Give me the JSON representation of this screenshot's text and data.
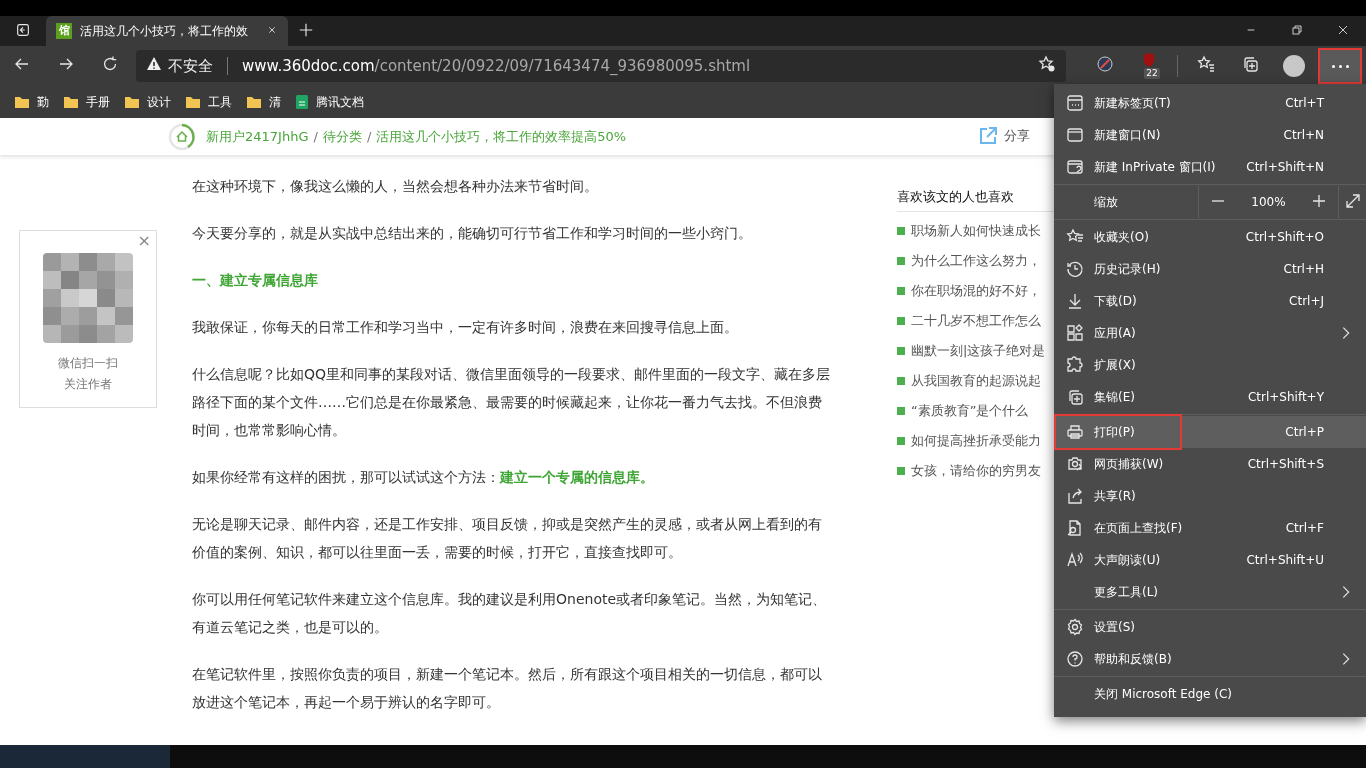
{
  "tab": {
    "favicon_text": "馆",
    "title": "活用这几个小技巧，将工作的效",
    "selected": true
  },
  "address": {
    "security": "不安全",
    "host": "www.360doc.com",
    "path": "/content/20/0922/09/71643474_936980095.shtml"
  },
  "extension_badge": "22",
  "more_button": {
    "highlighted": true
  },
  "bookmarks": [
    {
      "kind": "folder",
      "label": "勤"
    },
    {
      "kind": "folder",
      "label": "手册"
    },
    {
      "kind": "folder",
      "label": "设计"
    },
    {
      "kind": "folder",
      "label": "工具"
    },
    {
      "kind": "folder",
      "label": "清"
    },
    {
      "kind": "doc",
      "label": "腾讯文档"
    }
  ],
  "breadcrumb": {
    "separator": "/",
    "items": [
      "新用户2417JhhG",
      "待分类",
      "活用这几个小技巧，将工作的效率提高50%"
    ],
    "share": "分享"
  },
  "follow_card": {
    "scan": "微信扫一扫",
    "follow": "关注作者",
    "close": "×"
  },
  "article": [
    {
      "kind": "text",
      "text": "在这种环境下，像我这么懒的人，当然会想各种办法来节省时间。"
    },
    {
      "kind": "text",
      "text": "今天要分享的，就是从实战中总结出来的，能确切可行节省工作和学习时间的一些小窍门。"
    },
    {
      "kind": "heading",
      "text": "一、建立专属信息库"
    },
    {
      "kind": "text",
      "text": "我敢保证，你每天的日常工作和学习当中，一定有许多时间，浪费在来回搜寻信息上面。"
    },
    {
      "kind": "text",
      "text": "什么信息呢？比如QQ里和同事的某段对话、微信里面领导的一段要求、邮件里面的一段文字、藏在多层路径下面的某个文件……它们总是在你最紧急、最需要的时候藏起来，让你花一番力气去找。不但浪费时间，也常常影响心情。"
    },
    {
      "kind": "text",
      "text": "如果你经常有这样的困扰，那可以试试这个方法：**建立一个专属的信息库。**"
    },
    {
      "kind": "text",
      "text": "无论是聊天记录、邮件内容，还是工作安排、项目反馈，抑或是突然产生的灵感，或者从网上看到的有价值的案例、知识，都可以往里面一丢，需要的时候，打开它，直接查找即可。"
    },
    {
      "kind": "text",
      "text": "你可以用任何笔记软件来建立这个信息库。我的建议是利用Onenote或者印象笔记。当然，为知笔记、有道云笔记之类，也是可以的。"
    },
    {
      "kind": "text",
      "text": "在笔记软件里，按照你负责的项目，新建一个笔记本。然后，所有跟这个项目相关的一切信息，都可以放进这个笔记本，再起一个易于辨认的名字即可。"
    }
  ],
  "related": {
    "title": "喜欢该文的人也喜欢",
    "items": [
      "职场新人如何快速成长",
      "为什么工作这么努力，",
      "你在职场混的好不好，",
      "二十几岁不想工作怎么",
      "幽默一刻|这孩子绝对是",
      "从我国教育的起源说起",
      "“素质教育”是个什么",
      "如何提高挫折承受能力",
      "女孩，请给你的穷男友"
    ]
  },
  "menu": {
    "sections": [
      {
        "items": [
          {
            "kind": "item",
            "label": "新建标签页(T)",
            "shortcut": "Ctrl+T",
            "submenu": false,
            "highlighted": false
          },
          {
            "kind": "item",
            "label": "新建窗口(N)",
            "shortcut": "Ctrl+N",
            "submenu": false,
            "highlighted": false
          },
          {
            "kind": "item",
            "label": "新建 InPrivate 窗口(I)",
            "shortcut": "Ctrl+Shift+N",
            "submenu": false,
            "highlighted": false
          }
        ]
      },
      {
        "items": [
          {
            "kind": "zoom",
            "label": "缩放",
            "value": "100%"
          }
        ]
      },
      {
        "items": [
          {
            "kind": "item",
            "label": "收藏夹(O)",
            "shortcut": "Ctrl+Shift+O",
            "submenu": false,
            "highlighted": false
          },
          {
            "kind": "item",
            "label": "历史记录(H)",
            "shortcut": "Ctrl+H",
            "submenu": false,
            "highlighted": false
          },
          {
            "kind": "item",
            "label": "下载(D)",
            "shortcut": "Ctrl+J",
            "submenu": false,
            "highlighted": false
          },
          {
            "kind": "item",
            "label": "应用(A)",
            "submenu": true,
            "highlighted": false
          },
          {
            "kind": "item",
            "label": "扩展(X)",
            "submenu": false,
            "highlighted": false
          },
          {
            "kind": "item",
            "label": "集锦(E)",
            "shortcut": "Ctrl+Shift+Y",
            "submenu": false,
            "highlighted": false
          }
        ]
      },
      {
        "items": [
          {
            "kind": "item",
            "label": "打印(P)",
            "shortcut": "Ctrl+P",
            "submenu": false,
            "highlighted": true
          },
          {
            "kind": "item",
            "label": "网页捕获(W)",
            "shortcut": "Ctrl+Shift+S",
            "submenu": false,
            "highlighted": false
          },
          {
            "kind": "item",
            "label": "共享(R)",
            "submenu": false,
            "highlighted": false
          },
          {
            "kind": "item",
            "label": "在页面上查找(F)",
            "shortcut": "Ctrl+F",
            "submenu": false,
            "highlighted": false
          },
          {
            "kind": "item",
            "label": "大声朗读(U)",
            "shortcut": "Ctrl+Shift+U",
            "submenu": false,
            "highlighted": false
          },
          {
            "kind": "item",
            "label": "更多工具(L)",
            "submenu": true,
            "highlighted": false
          }
        ]
      },
      {
        "items": [
          {
            "kind": "item",
            "label": "设置(S)",
            "submenu": false,
            "highlighted": false
          },
          {
            "kind": "item",
            "label": "帮助和反馈(B)",
            "submenu": true,
            "highlighted": false
          }
        ]
      },
      {
        "items": [
          {
            "kind": "item",
            "label": "关闭 Microsoft Edge (C)",
            "submenu": false,
            "highlighted": false
          }
        ]
      }
    ]
  }
}
